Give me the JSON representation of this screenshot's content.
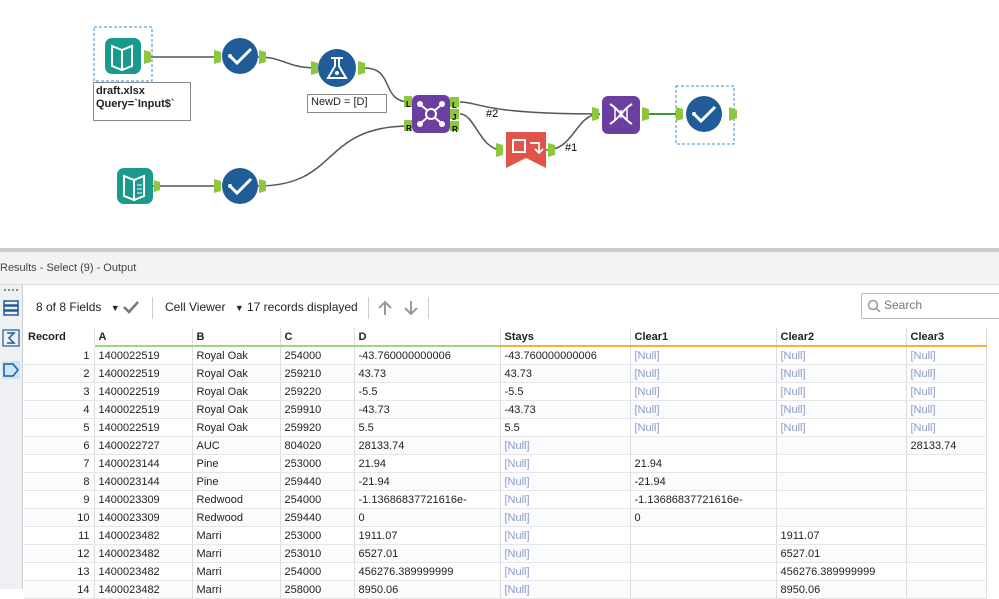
{
  "workflow": {
    "input_label_line1": "draft.xlsx",
    "input_label_line2": "Query=`Input$`",
    "formula_label": "NewD = [D]",
    "conn_label_2": "#2",
    "conn_label_1": "#1",
    "join_anchors": {
      "l_in": "L",
      "r_in": "R",
      "l_out": "L",
      "j_out": "J",
      "r_out": "R"
    },
    "colors": {
      "input": "#1a9a8c",
      "select": "#1f5c98",
      "formula": "#1f5c98",
      "join": "#6b3fa0",
      "union": "#6b3fa0",
      "transpose": "#e0554a",
      "connector": "#8ec63f"
    }
  },
  "results": {
    "title": "Results - Select (9) - Output",
    "fields_label": "8 of 8 Fields",
    "viewer_label": "Cell Viewer",
    "records_label": "17 records displayed",
    "search_placeholder": "Search",
    "columns": [
      "Record",
      "A",
      "B",
      "C",
      "D",
      "Stays",
      "Clear1",
      "Clear2",
      "Clear3"
    ],
    "rows": [
      [
        "1",
        "1400022519",
        "Royal Oak",
        "254000",
        "-43.760000000006",
        "-43.760000000006",
        "[Null]",
        "[Null]",
        "[Null]"
      ],
      [
        "2",
        "1400022519",
        "Royal Oak",
        "259210",
        "43.73",
        "43.73",
        "[Null]",
        "[Null]",
        "[Null]"
      ],
      [
        "3",
        "1400022519",
        "Royal Oak",
        "259220",
        "-5.5",
        "-5.5",
        "[Null]",
        "[Null]",
        "[Null]"
      ],
      [
        "4",
        "1400022519",
        "Royal Oak",
        "259910",
        "-43.73",
        "-43.73",
        "[Null]",
        "[Null]",
        "[Null]"
      ],
      [
        "5",
        "1400022519",
        "Royal Oak",
        "259920",
        "5.5",
        "5.5",
        "[Null]",
        "[Null]",
        "[Null]"
      ],
      [
        "6",
        "1400022727",
        "AUC",
        "804020",
        "28133.74",
        "[Null]",
        "",
        "",
        "28133.74"
      ],
      [
        "7",
        "1400023144",
        "Pine",
        "253000",
        "21.94",
        "[Null]",
        "21.94",
        "",
        ""
      ],
      [
        "8",
        "1400023144",
        "Pine",
        "259440",
        "-21.94",
        "[Null]",
        "-21.94",
        "",
        ""
      ],
      [
        "9",
        "1400023309",
        "Redwood",
        "254000",
        "-1.13686837721616e-",
        "[Null]",
        "-1.13686837721616e-",
        "",
        ""
      ],
      [
        "10",
        "1400023309",
        "Redwood",
        "259440",
        "0",
        "[Null]",
        "0",
        "",
        ""
      ],
      [
        "11",
        "1400023482",
        "Marri",
        "253000",
        "1911.07",
        "[Null]",
        "",
        "1911.07",
        ""
      ],
      [
        "12",
        "1400023482",
        "Marri",
        "253010",
        "6527.01",
        "[Null]",
        "",
        "6527.01",
        ""
      ],
      [
        "13",
        "1400023482",
        "Marri",
        "254000",
        "456276.389999999",
        "[Null]",
        "",
        "456276.389999999",
        ""
      ],
      [
        "14",
        "1400023482",
        "Marri",
        "258000",
        "8950.06",
        "[Null]",
        "",
        "8950.06",
        ""
      ]
    ]
  }
}
